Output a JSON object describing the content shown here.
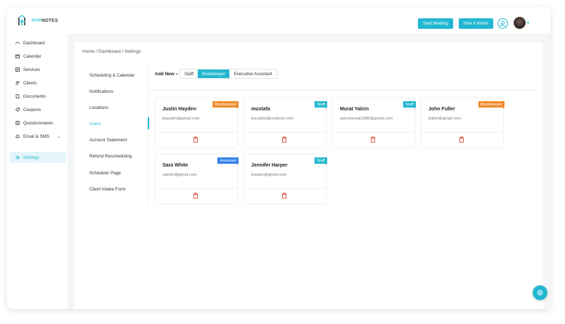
{
  "app": {
    "logo_prefix": "HYP",
    "logo_suffix": "NOTES"
  },
  "topbar": {
    "start_meeting": "Start Meeting",
    "how_it_works": "How It Works"
  },
  "sidebar": {
    "items": [
      {
        "label": "Dashboard",
        "icon": "dashboard-icon"
      },
      {
        "label": "Calendar",
        "icon": "calendar-icon"
      },
      {
        "label": "Services",
        "icon": "services-icon"
      },
      {
        "label": "Clients",
        "icon": "clients-icon"
      },
      {
        "label": "Documents",
        "icon": "documents-icon"
      },
      {
        "label": "Coupons",
        "icon": "coupon-icon"
      },
      {
        "label": "Questionnaires",
        "icon": "questionnaire-icon"
      },
      {
        "label": "Email & SMS",
        "icon": "bell-icon"
      },
      {
        "label": "Settings",
        "icon": "gear-icon"
      }
    ],
    "active": "Settings"
  },
  "breadcrumb": "Home / Dashboard / Settings",
  "settings_menu": [
    "Scheduling & Calendar",
    "Notifications",
    "Locations",
    "Users",
    "Account Statement",
    "Refund Rescheduling",
    "Scheduler Page",
    "Client Intake Form"
  ],
  "settings_active": "Users",
  "add_new": {
    "label": "Add New",
    "arrow": "»",
    "tabs": [
      "Staff",
      "Bookkeeper",
      "Executive Assistant"
    ],
    "active_tab": "Bookkeeper"
  },
  "users": [
    {
      "name": "Justin Hayden",
      "email": "jhayden@gmail.com",
      "role": "Bookkeeper"
    },
    {
      "name": "mustafa",
      "email": "kucukbal@outlook.com",
      "role": "Staff"
    },
    {
      "name": "Murat Yalcin",
      "email": "yalcinmurat1986@gmail.com",
      "role": "Staff"
    },
    {
      "name": "John Fuller",
      "email": "jfuller@gmail.com",
      "role": "Bookkeeper"
    },
    {
      "name": "Sara White",
      "email": "swhite@gmail.com",
      "role": "Assistant"
    },
    {
      "name": "Jennifer Harper",
      "email": "jharper@gmail.com",
      "role": "Staff"
    }
  ],
  "colors": {
    "accent": "#22b7d1",
    "bookkeeper": "#f0892a",
    "staff": "#22b7d1",
    "assistant": "#2f7fe8",
    "delete": "#e0453a"
  }
}
